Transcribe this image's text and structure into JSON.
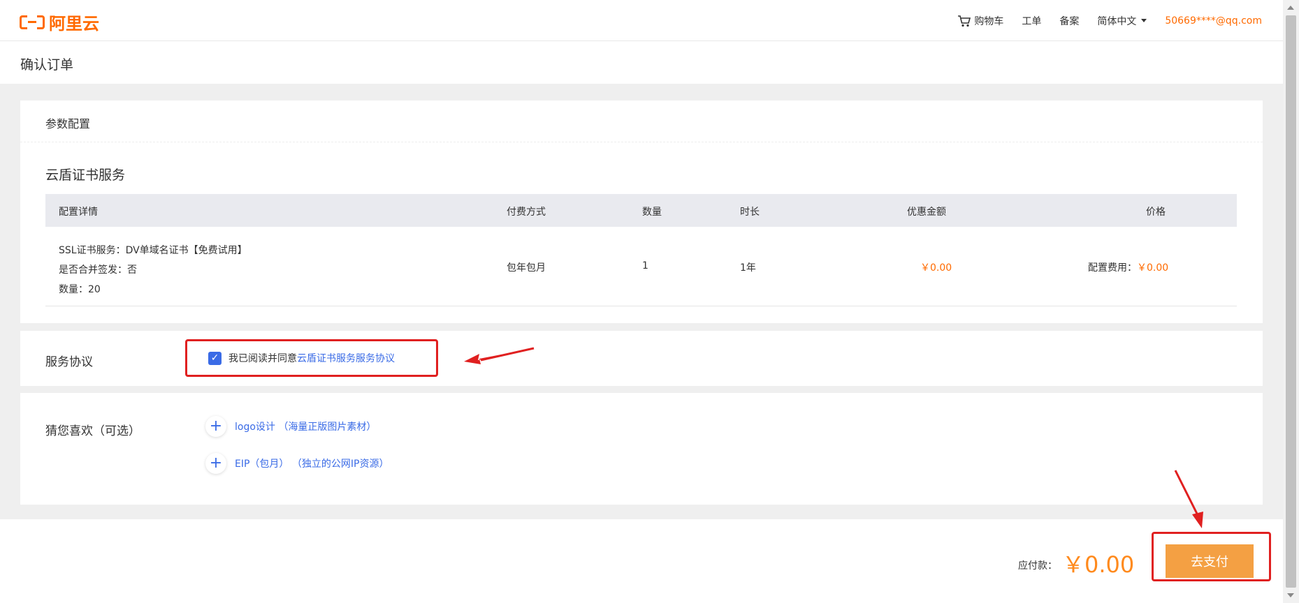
{
  "header": {
    "logo_text": "阿里云",
    "cart_label": "购物车",
    "ticket_label": "工单",
    "filing_label": "备案",
    "language_label": "简体中文",
    "user_email": "50669****@qq.com"
  },
  "page": {
    "title": "确认订单"
  },
  "config_card": {
    "heading": "参数配置",
    "product_title": "云盾证书服务",
    "columns": {
      "detail": "配置详情",
      "payment": "付费方式",
      "quantity": "数量",
      "duration": "时长",
      "discount": "优惠金额",
      "price": "价格"
    },
    "row": {
      "detail_line1": "SSL证书服务：DV单域名证书【免费试用】",
      "detail_line2": "是否合并签发：否",
      "detail_line3": "数量：20",
      "payment": "包年包月",
      "quantity": "1",
      "duration": "1年",
      "discount": "￥0.00",
      "price_label": "配置费用：",
      "price_value": "￥0.00"
    }
  },
  "agreement": {
    "label": "服务协议",
    "checked": true,
    "text": "我已阅读并同意",
    "link": "云盾证书服务服务协议"
  },
  "recommend": {
    "label": "猜您喜欢（可选）",
    "items": [
      {
        "text": "logo设计 （海量正版图片素材）"
      },
      {
        "text": "EIP（包月） （独立的公网IP资源）"
      }
    ]
  },
  "footer": {
    "due_label": "应付款：",
    "due_amount": "￥0.00",
    "pay_button": "去支付"
  },
  "colors": {
    "brand_orange": "#ff6a00",
    "link_blue": "#3a6be6",
    "highlight_red": "#e02020",
    "pay_button": "#f4a043"
  }
}
